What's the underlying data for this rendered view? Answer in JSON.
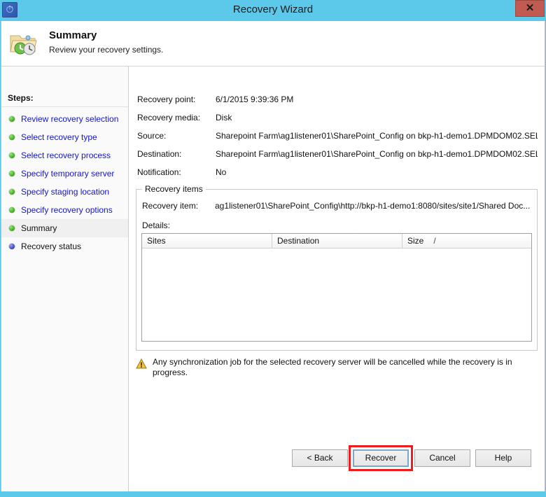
{
  "window": {
    "title": "Recovery Wizard",
    "app_icon": "recovery-clock-icon",
    "close_label": "✕"
  },
  "header": {
    "icon": "folder-clock-icon",
    "title": "Summary",
    "subtitle": "Review your recovery settings."
  },
  "sidebar": {
    "label": "Steps:",
    "items": [
      {
        "label": "Review recovery selection",
        "state": "done"
      },
      {
        "label": "Select recovery type",
        "state": "done"
      },
      {
        "label": "Select recovery process",
        "state": "done"
      },
      {
        "label": "Specify temporary server",
        "state": "done"
      },
      {
        "label": "Specify staging location",
        "state": "done"
      },
      {
        "label": "Specify recovery options",
        "state": "done"
      },
      {
        "label": "Summary",
        "state": "current"
      },
      {
        "label": "Recovery status",
        "state": "pending"
      }
    ]
  },
  "summary": {
    "rows": [
      {
        "label": "Recovery point:",
        "value": "6/1/2015 9:39:36 PM"
      },
      {
        "label": "Recovery media:",
        "value": "Disk"
      },
      {
        "label": "Source:",
        "value": "Sharepoint Farm\\ag1listener01\\SharePoint_Config on bkp-h1-demo1.DPMDOM02.SEL..."
      },
      {
        "label": "Destination:",
        "value": "Sharepoint Farm\\ag1listener01\\SharePoint_Config on bkp-h1-demo1.DPMDOM02.SEL..."
      },
      {
        "label": "Notification:",
        "value": "No"
      }
    ]
  },
  "recovery_items": {
    "legend": "Recovery items",
    "item_label": "Recovery item:",
    "item_value": "ag1listener01\\SharePoint_Config\\http://bkp-h1-demo1:8080/sites/site1/Shared Doc...",
    "details_label": "Details:",
    "columns": [
      "Sites",
      "Destination",
      "Size"
    ],
    "sort_indicator": "/",
    "rows": []
  },
  "warning": {
    "icon": "warning-triangle-icon",
    "text": "Any synchronization job for the selected recovery server will be cancelled while the recovery is in progress."
  },
  "footer": {
    "back": "< Back",
    "recover": "Recover",
    "cancel": "Cancel",
    "help": "Help"
  },
  "colors": {
    "titlebar": "#5cc8ea",
    "close_button": "#c15b52",
    "step_link": "#1515cc",
    "step_done_bullet": "#49b62b",
    "step_pending_bullet": "#4a55c7",
    "highlight_box": "#ee1c1c",
    "focus_border": "#7aa7cc",
    "warning_icon": "#f0c419"
  }
}
